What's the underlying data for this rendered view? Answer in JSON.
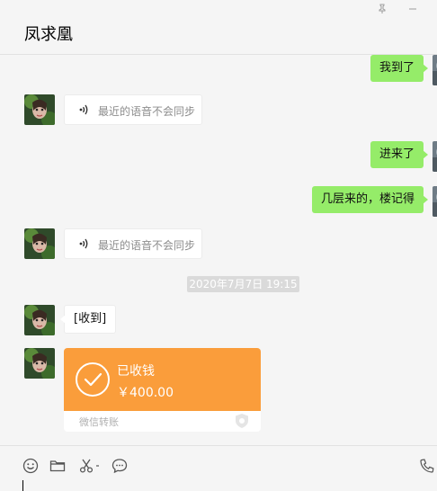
{
  "window": {
    "title": "凤求凰",
    "pin_icon": "pin-icon",
    "minimize_icon": "minimize-icon"
  },
  "messages": {
    "m1": {
      "side": "right",
      "text": "我到了"
    },
    "m2": {
      "side": "left",
      "voice_text": "最近的语音不会同步"
    },
    "m3": {
      "side": "right",
      "text": "进来了"
    },
    "m4": {
      "side": "right",
      "text": "几层来的，楼记得"
    },
    "m5": {
      "side": "left",
      "voice_text": "最近的语音不会同步"
    },
    "timestamp": "2020年7月7日 19:15",
    "m6": {
      "side": "left",
      "text": "[收到]"
    },
    "transfer": {
      "status": "已收钱",
      "amount": "￥400.00",
      "footer": "微信转账",
      "color": "#fa9d3b"
    }
  },
  "toolbar": {
    "icons": [
      "emoji-icon",
      "folder-icon",
      "scissors-icon",
      "chat-history-icon",
      "phone-icon"
    ]
  },
  "colors": {
    "sent_bubble": "#95ec69",
    "received_bubble": "#ffffff",
    "transfer": "#fa9d3b"
  }
}
